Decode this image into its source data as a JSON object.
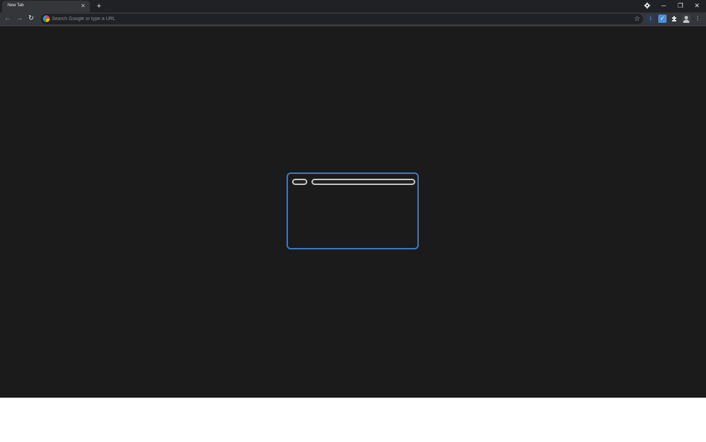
{
  "tab": {
    "title": "New Tab",
    "close_glyph": "✕"
  },
  "tabstrip": {
    "new_tab_glyph": "+",
    "profile_icon": "gear-icon",
    "minimize_glyph": "─",
    "maximize_glyph": "❐",
    "close_glyph": "✕"
  },
  "toolbar": {
    "back_glyph": "←",
    "forward_glyph": "→",
    "reload_glyph": "↻",
    "omnibox_placeholder": "Search Google or type a URL",
    "bookmark_glyph": "☆",
    "menu_glyph": "⋮"
  },
  "colors": {
    "page_bg": "#1b1b1b",
    "dialog_border": "#3d7ac4",
    "pill_border": "#c8c8c8"
  }
}
